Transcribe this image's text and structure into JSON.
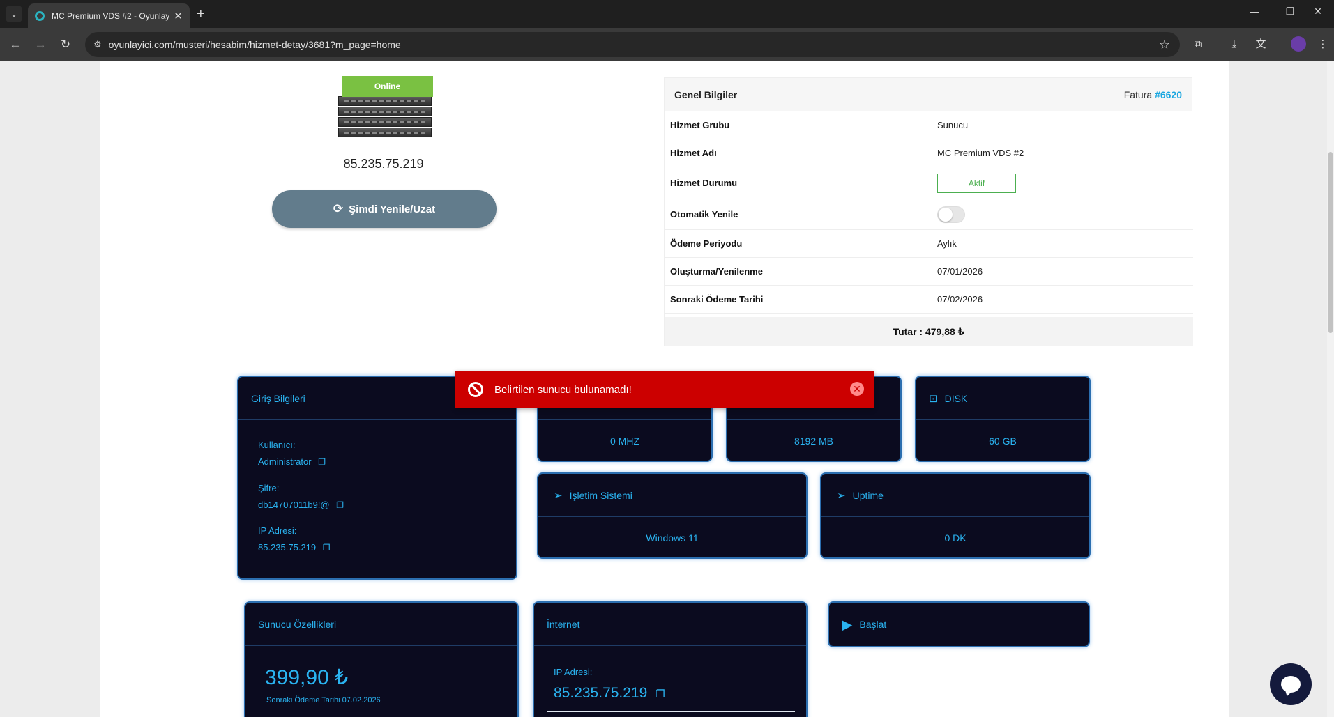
{
  "browser": {
    "tab_title": "MC Premium VDS #2 - Oyunlay",
    "url": "oyunlayici.com/musteri/hesabim/hizmet-detay/3681?m_page=home"
  },
  "server": {
    "status_badge": "Online",
    "ip": "85.235.75.219",
    "renew_button": "Şimdi Yenile/Uzat"
  },
  "general": {
    "title": "Genel Bilgiler",
    "invoice_label": "Fatura",
    "invoice_no": "#6620",
    "rows": [
      {
        "key": "Hizmet Grubu",
        "value": "Sunucu"
      },
      {
        "key": "Hizmet Adı",
        "value": "MC Premium VDS #2"
      },
      {
        "key": "Hizmet Durumu",
        "value": "Aktif"
      },
      {
        "key": "Otomatik Yenile",
        "value": ""
      },
      {
        "key": "Ödeme Periyodu",
        "value": "Aylık"
      },
      {
        "key": "Oluşturma/Yenilenme",
        "value": "07/01/2026"
      },
      {
        "key": "Sonraki Ödeme Tarihi",
        "value": "07/02/2026"
      }
    ],
    "auto_renew_on": false,
    "total": "Tutar : 479,88 ₺"
  },
  "login": {
    "title": "Giriş Bilgileri",
    "user_label": "Kullanıcı:",
    "user_value": "Administrator",
    "pass_label": "Şifre:",
    "pass_value": "db14707011b9!@",
    "ip_label": "IP Adresi:",
    "ip_value": "85.235.75.219"
  },
  "stats": {
    "cpu_value": "0 MHZ",
    "ram_value": "8192 MB",
    "disk_title": "DISK",
    "disk_value": "60 GB",
    "os_title": "İşletim Sistemi",
    "os_value": "Windows 11",
    "uptime_title": "Uptime",
    "uptime_value": "0 DK"
  },
  "features": {
    "title": "Sunucu Özellikleri",
    "price": "399,90 ₺",
    "next_payment": "Sonraki Ödeme Tarihi 07.02.2026"
  },
  "internet": {
    "title": "İnternet",
    "ip_label": "IP Adresi:",
    "ip_value": "85.235.75.219"
  },
  "actions": {
    "start_label": "Başlat"
  },
  "toast": {
    "message": "Belirtilen sunucu bulunamadı!"
  },
  "colors": {
    "accent": "#2ab3f0",
    "card_bg": "#0b0b1f",
    "error": "#cc0000",
    "online": "#7ac142",
    "button": "#627c8c"
  }
}
